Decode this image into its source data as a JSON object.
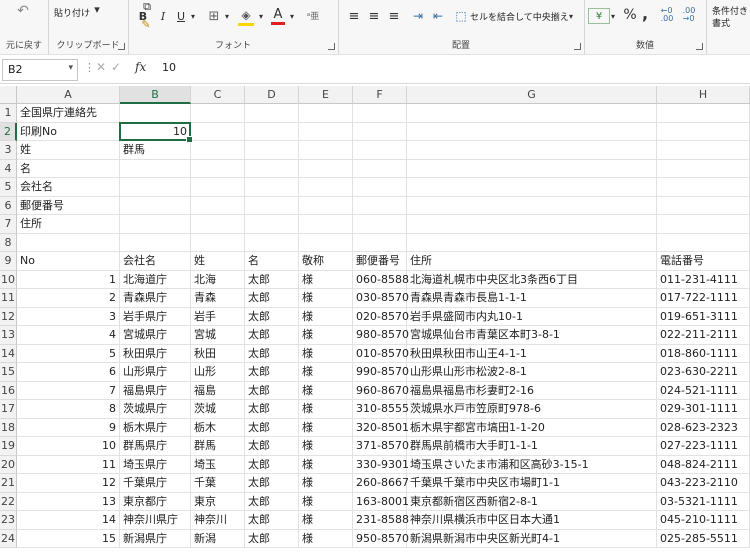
{
  "ribbon": {
    "undo_label": "元に戻す",
    "clipboard": {
      "label": "クリップボード",
      "paste_label": "貼り付け"
    },
    "font": {
      "label": "フォント",
      "bold": "B",
      "italic": "I",
      "underline": "U",
      "font_color_letter": "A"
    },
    "align": {
      "label": "配置",
      "merge_label": "セルを結合して中央揃え"
    },
    "number": {
      "label": "数値",
      "percent": "%",
      "comma": ","
    },
    "cond_format_label": "条件付き書式"
  },
  "formula_bar": {
    "name_box": "B2",
    "fx": "fx",
    "value": "10"
  },
  "columns": [
    "A",
    "B",
    "C",
    "D",
    "E",
    "F",
    "G",
    "H"
  ],
  "selected_cell": "B2",
  "rows": [
    {
      "n": "1",
      "cells": [
        "全国県庁連絡先",
        "",
        "",
        "",
        "",
        "",
        "",
        ""
      ]
    },
    {
      "n": "2",
      "cells": [
        "印刷No",
        "10",
        "",
        "",
        "",
        "",
        "",
        ""
      ]
    },
    {
      "n": "3",
      "cells": [
        "姓",
        "群馬",
        "",
        "",
        "",
        "",
        "",
        ""
      ]
    },
    {
      "n": "4",
      "cells": [
        "名",
        "",
        "",
        "",
        "",
        "",
        "",
        ""
      ]
    },
    {
      "n": "5",
      "cells": [
        "会社名",
        "",
        "",
        "",
        "",
        "",
        "",
        ""
      ]
    },
    {
      "n": "6",
      "cells": [
        "郵便番号",
        "",
        "",
        "",
        "",
        "",
        "",
        ""
      ]
    },
    {
      "n": "7",
      "cells": [
        "住所",
        "",
        "",
        "",
        "",
        "",
        "",
        ""
      ]
    },
    {
      "n": "8",
      "cells": [
        "",
        "",
        "",
        "",
        "",
        "",
        "",
        ""
      ]
    },
    {
      "n": "9",
      "cells": [
        "No",
        "会社名",
        "姓",
        "名",
        "敬称",
        "郵便番号",
        "住所",
        "電話番号"
      ]
    },
    {
      "n": "10",
      "cells": [
        "1",
        "北海道庁",
        "北海",
        "太郎",
        "様",
        "060-8588",
        "北海道札幌市中央区北3条西6丁目",
        "011-231-4111"
      ]
    },
    {
      "n": "11",
      "cells": [
        "2",
        "青森県庁",
        "青森",
        "太郎",
        "様",
        "030-8570",
        "青森県青森市長島1-1-1",
        "017-722-1111"
      ]
    },
    {
      "n": "12",
      "cells": [
        "3",
        "岩手県庁",
        "岩手",
        "太郎",
        "様",
        "020-8570",
        "岩手県盛岡市内丸10-1",
        "019-651-3111"
      ]
    },
    {
      "n": "13",
      "cells": [
        "4",
        "宮城県庁",
        "宮城",
        "太郎",
        "様",
        "980-8570",
        "宮城県仙台市青葉区本町3-8-1",
        "022-211-2111"
      ]
    },
    {
      "n": "14",
      "cells": [
        "5",
        "秋田県庁",
        "秋田",
        "太郎",
        "様",
        "010-8570",
        "秋田県秋田市山王4-1-1",
        "018-860-1111"
      ]
    },
    {
      "n": "15",
      "cells": [
        "6",
        "山形県庁",
        "山形",
        "太郎",
        "様",
        "990-8570",
        "山形県山形市松波2-8-1",
        "023-630-2211"
      ]
    },
    {
      "n": "16",
      "cells": [
        "7",
        "福島県庁",
        "福島",
        "太郎",
        "様",
        "960-8670",
        "福島県福島市杉妻町2-16",
        "024-521-1111"
      ]
    },
    {
      "n": "17",
      "cells": [
        "8",
        "茨城県庁",
        "茨城",
        "太郎",
        "様",
        "310-8555",
        "茨城県水戸市笠原町978-6",
        "029-301-1111"
      ]
    },
    {
      "n": "18",
      "cells": [
        "9",
        "栃木県庁",
        "栃木",
        "太郎",
        "様",
        "320-8501",
        "栃木県宇都宮市塙田1-1-20",
        "028-623-2323"
      ]
    },
    {
      "n": "19",
      "cells": [
        "10",
        "群馬県庁",
        "群馬",
        "太郎",
        "様",
        "371-8570",
        "群馬県前橋市大手町1-1-1",
        "027-223-1111"
      ]
    },
    {
      "n": "20",
      "cells": [
        "11",
        "埼玉県庁",
        "埼玉",
        "太郎",
        "様",
        "330-9301",
        "埼玉県さいたま市浦和区高砂3-15-1",
        "048-824-2111"
      ]
    },
    {
      "n": "21",
      "cells": [
        "12",
        "千葉県庁",
        "千葉",
        "太郎",
        "様",
        "260-8667",
        "千葉県千葉市中央区市場町1-1",
        "043-223-2110"
      ]
    },
    {
      "n": "22",
      "cells": [
        "13",
        "東京都庁",
        "東京",
        "太郎",
        "様",
        "163-8001",
        "東京都新宿区西新宿2-8-1",
        "03-5321-1111"
      ]
    },
    {
      "n": "23",
      "cells": [
        "14",
        "神奈川県庁",
        "神奈川",
        "太郎",
        "様",
        "231-8588",
        "神奈川県横浜市中区日本大通1",
        "045-210-1111"
      ]
    },
    {
      "n": "24",
      "cells": [
        "15",
        "新潟県庁",
        "新潟",
        "太郎",
        "様",
        "950-8570",
        "新潟県新潟市中央区新光町4-1",
        "025-285-5511"
      ]
    }
  ]
}
